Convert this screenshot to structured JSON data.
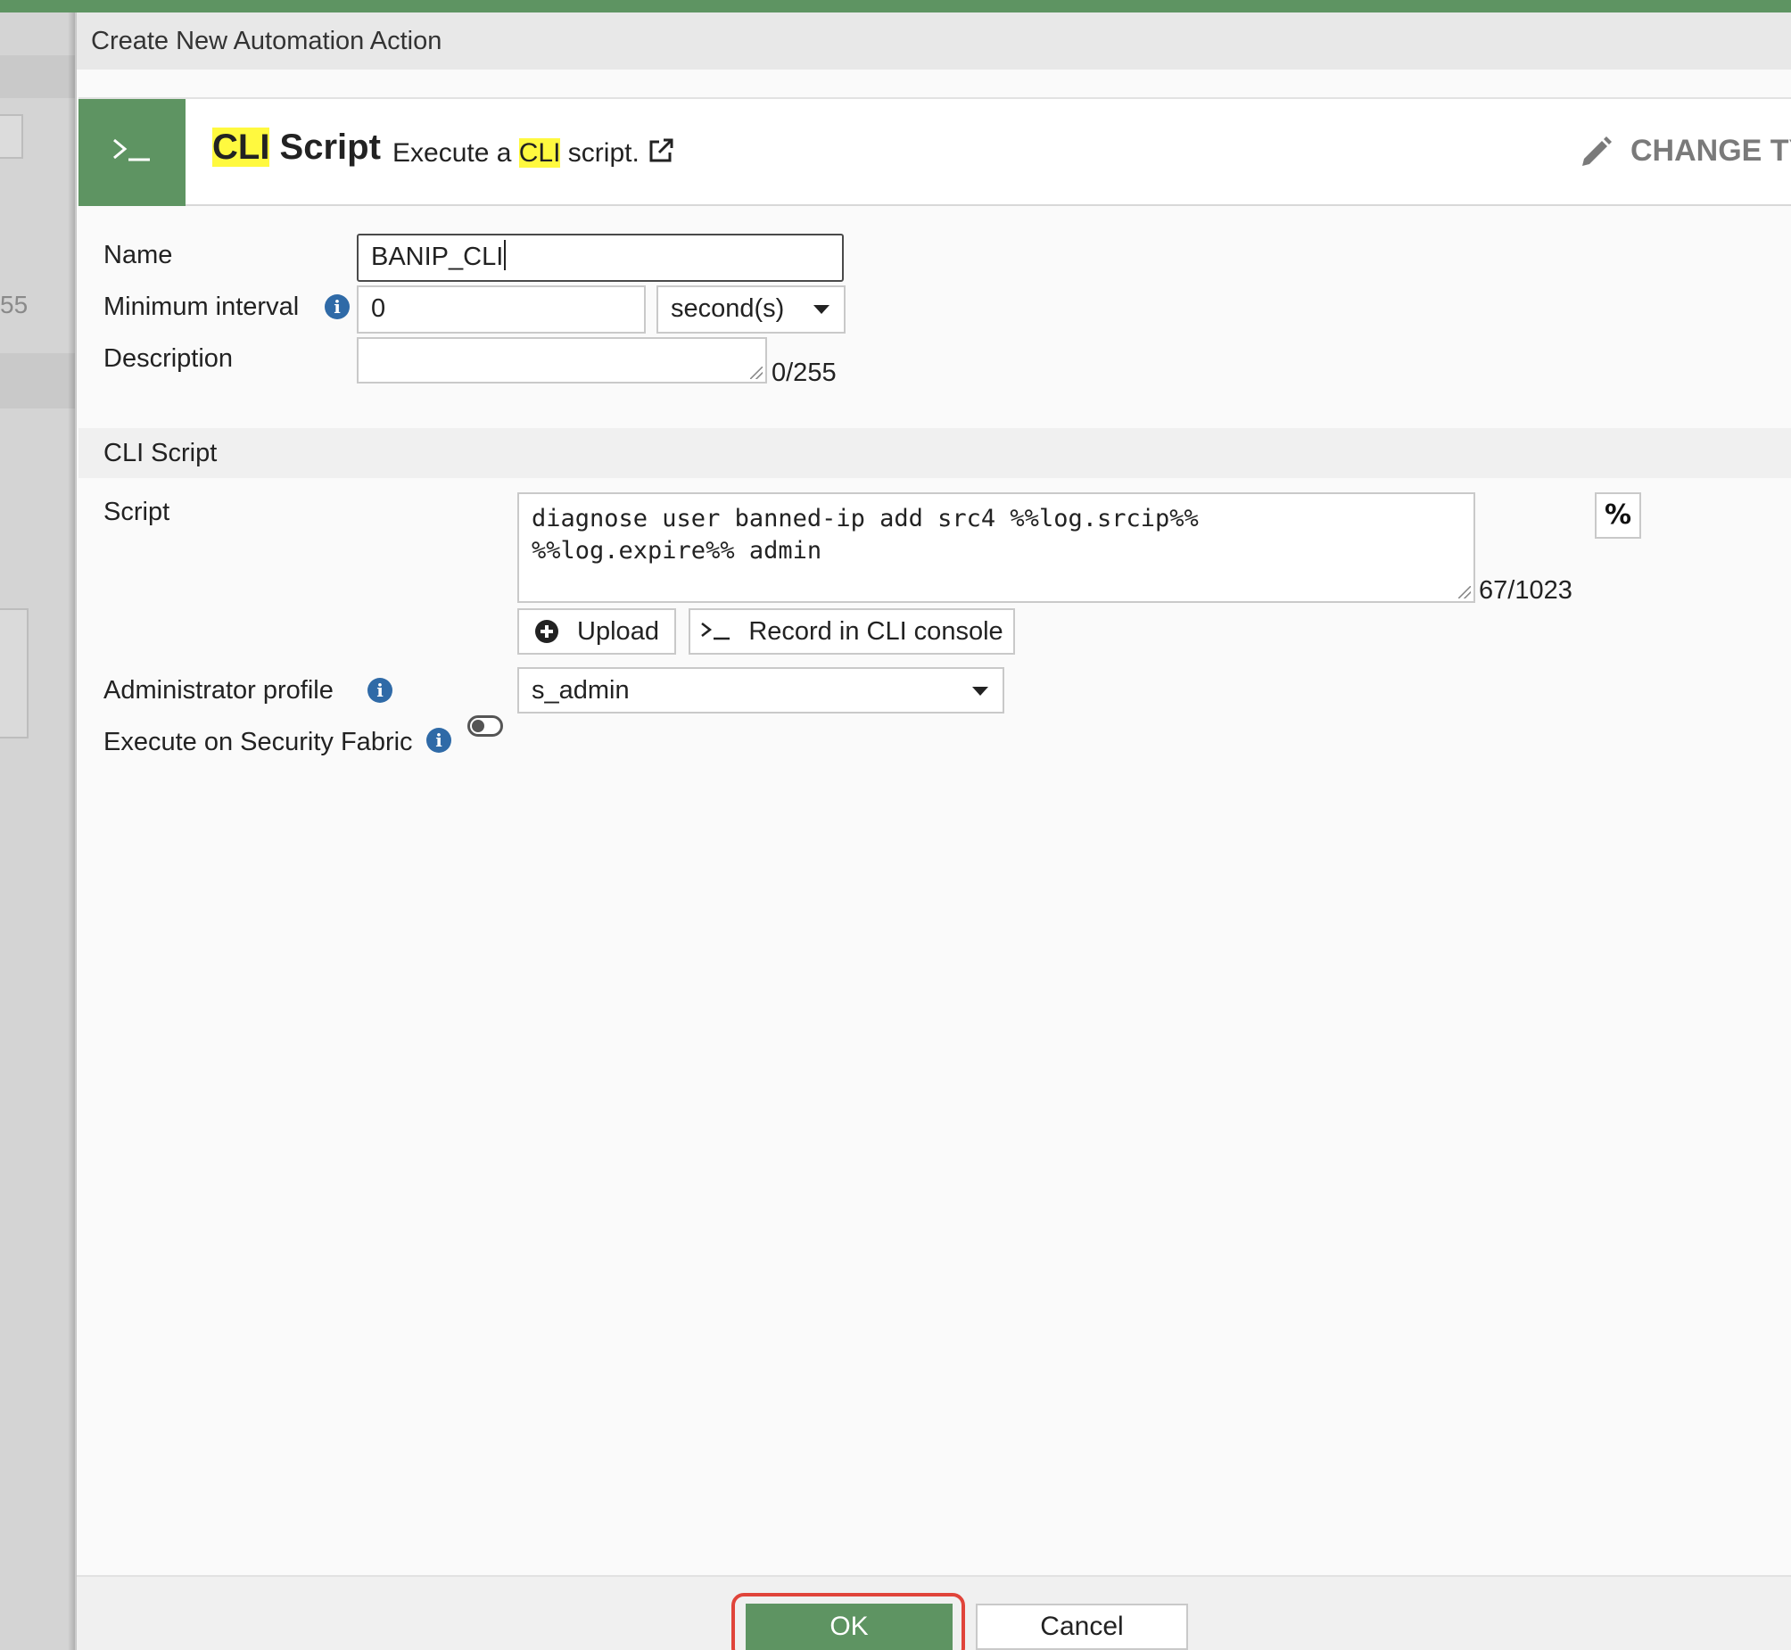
{
  "dialog": {
    "title": "Create New Automation Action"
  },
  "action_type": {
    "title_highlight": "CLI",
    "title_rest": " Script",
    "desc_prefix": "Execute a ",
    "desc_highlight": "CLI",
    "desc_suffix": " script.",
    "change_type_label": "CHANGE TY",
    "icons": {
      "type": "terminal-icon",
      "external": "external-link-icon",
      "change": "pencil-icon"
    },
    "accent_color": "#5e9462",
    "highlight_color": "#fff93f"
  },
  "background_page": {
    "partial_text": "55"
  },
  "form": {
    "name": {
      "label": "Name",
      "value": "BANIP_CLI"
    },
    "minimum_interval": {
      "label": "Minimum interval",
      "value": "0",
      "unit": "second(s)"
    },
    "description": {
      "label": "Description",
      "value": "",
      "counter": "0/255"
    }
  },
  "cli_section": {
    "title": "CLI Script",
    "script": {
      "label": "Script",
      "value": "diagnose user banned-ip add src4 %%log.srcip%%\n%%log.expire%% admin",
      "counter": "67/1023",
      "variable_button": "%"
    },
    "upload_label": "Upload",
    "record_label": "Record in CLI console",
    "admin_profile": {
      "label": "Administrator profile",
      "value": "s_admin"
    },
    "execute_fabric": {
      "label": "Execute on Security Fabric",
      "enabled": false
    }
  },
  "footer": {
    "ok_label": "OK",
    "cancel_label": "Cancel",
    "highlight_color": "#e0443a"
  }
}
